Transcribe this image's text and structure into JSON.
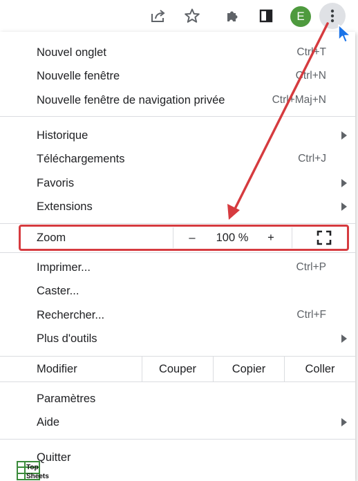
{
  "toolbar": {
    "avatar_letter": "E",
    "icons": [
      "share-icon",
      "bookmark-star-icon",
      "extensions-puzzle-icon",
      "side-panel-icon",
      "kebab-menu-icon"
    ]
  },
  "menu": {
    "new_tab": {
      "label": "Nouvel onglet",
      "shortcut": "Ctrl+T"
    },
    "new_window": {
      "label": "Nouvelle fenêtre",
      "shortcut": "Ctrl+N"
    },
    "new_incognito": {
      "label": "Nouvelle fenêtre de navigation privée",
      "shortcut": "Ctrl+Maj+N"
    },
    "history": {
      "label": "Historique"
    },
    "downloads": {
      "label": "Téléchargements",
      "shortcut": "Ctrl+J"
    },
    "bookmarks": {
      "label": "Favoris"
    },
    "extensions": {
      "label": "Extensions"
    },
    "zoom": {
      "label": "Zoom",
      "minus": "–",
      "value": "100 %",
      "plus": "+"
    },
    "print": {
      "label": "Imprimer...",
      "shortcut": "Ctrl+P"
    },
    "cast": {
      "label": "Caster..."
    },
    "find": {
      "label": "Rechercher...",
      "shortcut": "Ctrl+F"
    },
    "more_tools": {
      "label": "Plus d'outils"
    },
    "edit": {
      "label": "Modifier",
      "cut": "Couper",
      "copy": "Copier",
      "paste": "Coller"
    },
    "settings": {
      "label": "Paramètres"
    },
    "help": {
      "label": "Aide"
    },
    "quit": {
      "label": "Quitter"
    }
  },
  "annotation": {
    "color": "#d63b3f"
  },
  "watermark": {
    "line1": "Top",
    "line2": "Sheets"
  },
  "colors": {
    "avatar": "#4e9a3e",
    "cursor": "#1a73e8"
  }
}
